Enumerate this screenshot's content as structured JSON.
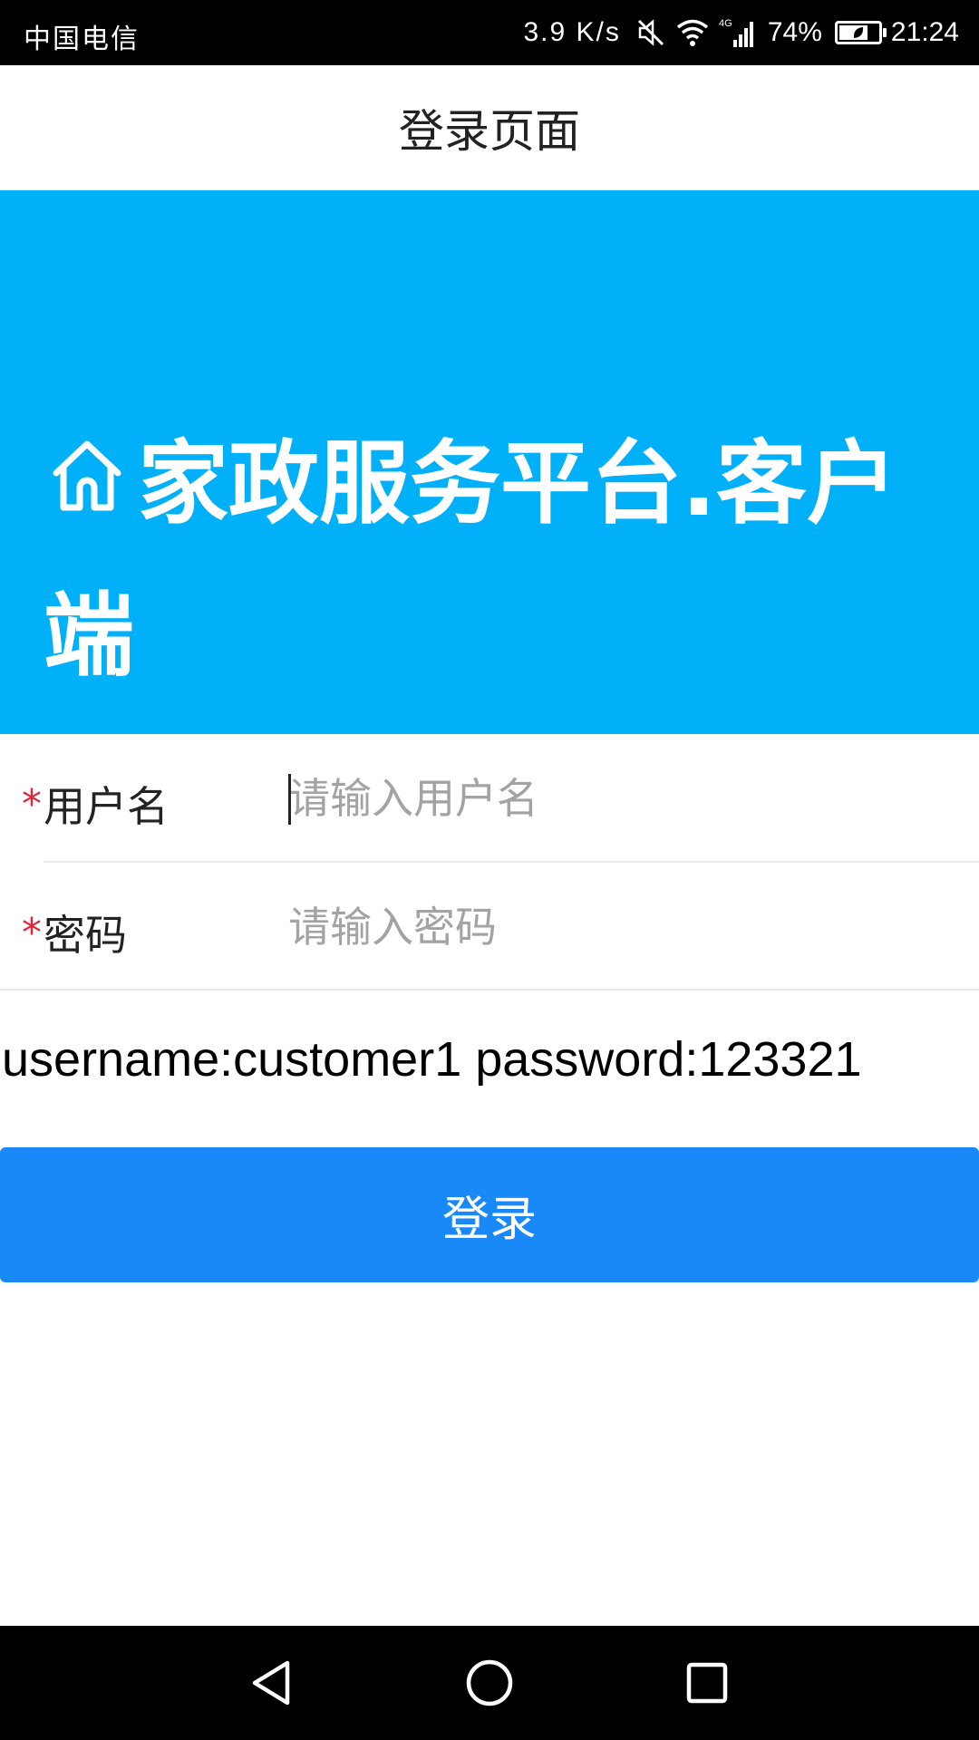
{
  "status_bar": {
    "carrier": "中国电信",
    "net_speed": "3.9 K/s",
    "network_type": "4G",
    "battery_percent": "74%",
    "battery_level": 0.74,
    "time": "21:24"
  },
  "header": {
    "title": "登录页面"
  },
  "banner": {
    "icon": "home-icon",
    "brand": "家政服务平台.客户端",
    "background_color": "#00b0f9"
  },
  "form": {
    "username": {
      "required_mark": "*",
      "label": "用户名",
      "placeholder": "请输入用户名",
      "value": ""
    },
    "password": {
      "required_mark": "*",
      "label": "密码",
      "placeholder": "请输入密码",
      "value": ""
    }
  },
  "hint": "username:customer1 password:123321",
  "login_button": {
    "label": "登录",
    "color": "#1989fa"
  },
  "nav_bar": {
    "icons": [
      "back-icon",
      "home-circle-icon",
      "recent-apps-icon"
    ]
  }
}
